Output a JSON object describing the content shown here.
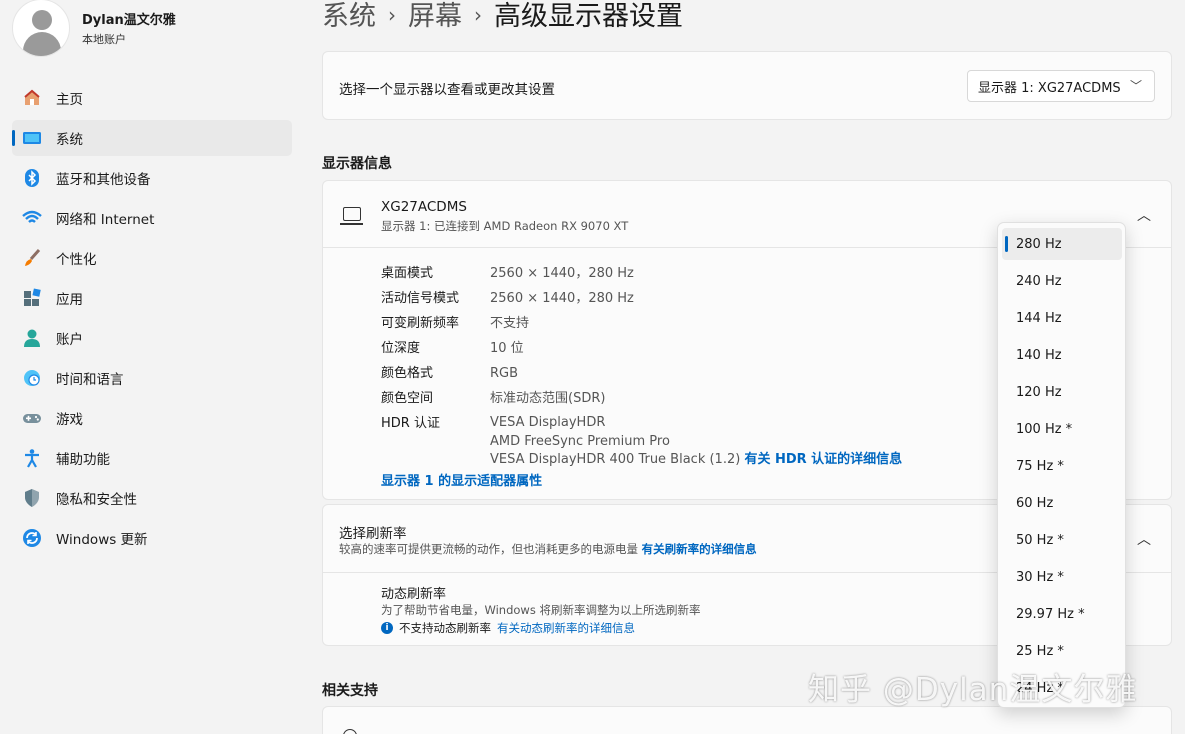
{
  "profile": {
    "name": "Dylan温文尔雅",
    "account_type": "本地账户"
  },
  "sidebar": {
    "items": [
      {
        "label": "主页",
        "icon": "home-icon"
      },
      {
        "label": "系统",
        "icon": "system-icon",
        "active": true
      },
      {
        "label": "蓝牙和其他设备",
        "icon": "bluetooth-icon"
      },
      {
        "label": "网络和 Internet",
        "icon": "wifi-icon"
      },
      {
        "label": "个性化",
        "icon": "brush-icon"
      },
      {
        "label": "应用",
        "icon": "apps-icon"
      },
      {
        "label": "账户",
        "icon": "person-icon"
      },
      {
        "label": "时间和语言",
        "icon": "clock-globe-icon"
      },
      {
        "label": "游戏",
        "icon": "gamepad-icon"
      },
      {
        "label": "辅助功能",
        "icon": "accessibility-icon"
      },
      {
        "label": "隐私和安全性",
        "icon": "shield-icon"
      },
      {
        "label": "Windows 更新",
        "icon": "update-icon"
      }
    ]
  },
  "breadcrumb": [
    "系统",
    "屏幕",
    "高级显示器设置"
  ],
  "select_display": {
    "label": "选择一个显示器以查看或更改其设置",
    "value": "显示器 1: XG27ACDMS"
  },
  "display_info": {
    "section_title": "显示器信息",
    "device_name": "XG27ACDMS",
    "device_sub": "显示器 1: 已连接到 AMD Radeon RX 9070 XT",
    "props": [
      {
        "key": "桌面模式",
        "value": "2560 × 1440，280 Hz"
      },
      {
        "key": "活动信号模式",
        "value": "2560 × 1440，280 Hz"
      },
      {
        "key": "可变刷新频率",
        "value": "不支持"
      },
      {
        "key": "位深度",
        "value": "10 位"
      },
      {
        "key": "颜色格式",
        "value": "RGB"
      },
      {
        "key": "颜色空间",
        "value": "标准动态范围(SDR)"
      }
    ],
    "hdr_key": "HDR 认证",
    "hdr_values": [
      "VESA DisplayHDR",
      "AMD FreeSync Premium Pro",
      "VESA DisplayHDR 400 True Black (1.2)"
    ],
    "hdr_link": "有关 HDR 认证的详细信息",
    "adapter_link": "显示器 1 的显示适配器属性"
  },
  "refresh": {
    "title": "选择刷新率",
    "subtitle": "较高的速率可提供更流畅的动作，但也消耗更多的电源电量",
    "subtitle_link": "有关刷新率的详细信息",
    "dynamic_title": "动态刷新率",
    "dynamic_sub": "为了帮助节省电量，Windows 将刷新率调整为以上所选刷新率",
    "dynamic_note": "不支持动态刷新率",
    "dynamic_link": "有关动态刷新率的详细信息",
    "options": [
      "280 Hz",
      "240 Hz",
      "144 Hz",
      "140 Hz",
      "120 Hz",
      "100 Hz *",
      "75 Hz *",
      "60 Hz",
      "50 Hz *",
      "30 Hz *",
      "29.97 Hz *",
      "25 Hz *",
      "24 Hz *"
    ],
    "selected": "280 Hz"
  },
  "related": {
    "title": "相关支持"
  },
  "watermark": "知乎 @Dylan温文尔雅",
  "colors": {
    "accent": "#0067c0",
    "background": "#f3f3f3",
    "card": "#fbfbfb"
  }
}
